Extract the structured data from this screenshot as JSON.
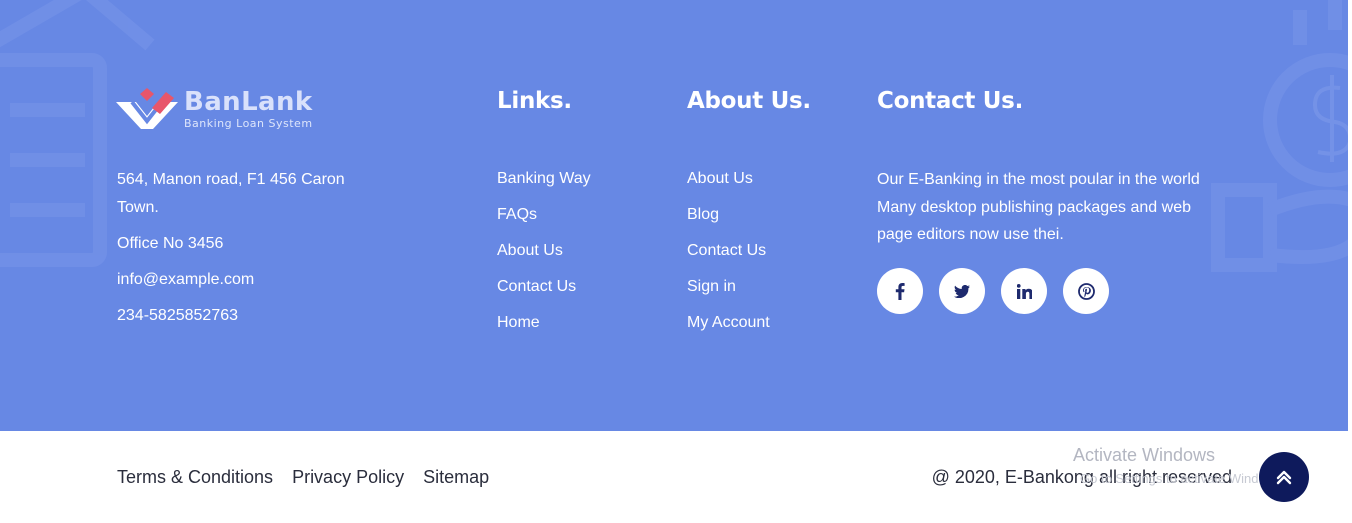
{
  "colors": {
    "footer_bg": "#6788e4",
    "heading": "#ffffff",
    "text_dark": "#2a2d3c",
    "scroll_button": "#0e1a5c",
    "logo_accent": "#e8566a"
  },
  "brand": {
    "name": "BanLank",
    "tagline": "Banking Loan System",
    "icon": "banlank-logo-icon"
  },
  "address": {
    "street": "564, Manon road, F1 456 Caron Town.",
    "office": "Office No 3456",
    "email": "info@example.com",
    "phone": "234-5825852763"
  },
  "links_column": {
    "title": "Links.",
    "items": [
      "Banking Way",
      "FAQs",
      "About Us",
      "Contact Us",
      "Home"
    ]
  },
  "about_column": {
    "title": "About Us.",
    "items": [
      "About Us",
      "Blog",
      "Contact Us",
      "Sign in",
      "My Account"
    ]
  },
  "contact_column": {
    "title": "Contact Us.",
    "text": "Our E-Banking in the most poular in the world Many desktop publishing packages and web page editors now use thei."
  },
  "social": [
    {
      "name": "facebook",
      "icon": "facebook-icon"
    },
    {
      "name": "twitter",
      "icon": "twitter-icon"
    },
    {
      "name": "linkedin",
      "icon": "linkedin-icon"
    },
    {
      "name": "pinterest",
      "icon": "pinterest-icon"
    }
  ],
  "bottom": {
    "links": [
      "Terms & Conditions",
      "Privacy Policy",
      "Sitemap"
    ],
    "copyright": "@ 2020, E-Bankong all right reserved",
    "watermark_title": "Activate Windows",
    "watermark_sub": "Go to Settings to activate Windows.",
    "scroll_top_icon": "double-chevron-up-icon"
  }
}
